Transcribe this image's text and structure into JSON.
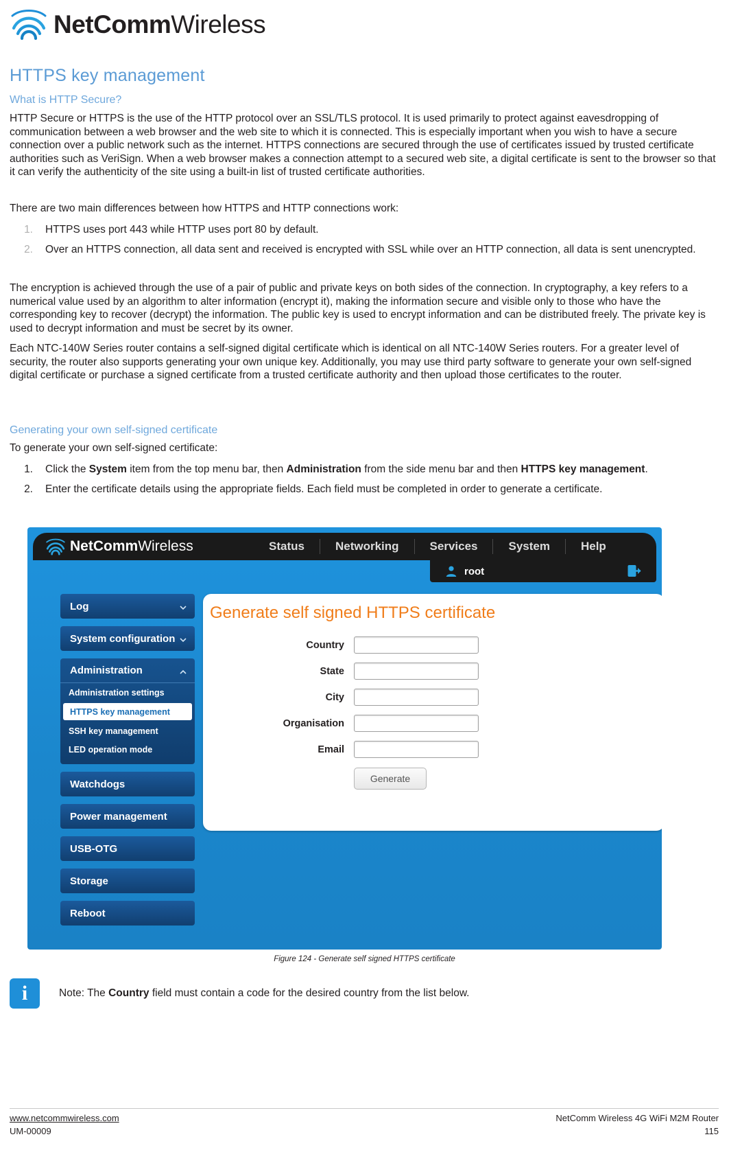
{
  "brand": {
    "name_bold": "NetComm",
    "name_light": "Wireless",
    "logo_icon": "wifi-wave-logo"
  },
  "document": {
    "title": "HTTPS key management",
    "subheading_1": "What is HTTP Secure?",
    "paragraphs": {
      "p1": "HTTP Secure or HTTPS is the use of the HTTP protocol over an SSL/TLS protocol. It is used primarily to protect against eavesdropping of communication between a web browser and the web site to which it is connected. This is especially important when you wish to have a secure connection over a public network such as the internet. HTTPS connections are secured through the use of certificates issued by trusted certificate authorities such as VeriSign. When a web browser makes a connection attempt to a secured web site, a digital certificate is sent to the browser so that it can verify the authenticity of the site using a built-in list of trusted certificate authorities.",
      "p2": "There are two main differences between how HTTPS and HTTP connections work:",
      "p3": "The encryption is achieved through the use of a pair of public and private keys on both sides of the connection. In cryptography, a key refers to a numerical value used by an algorithm to alter information (encrypt it), making the information secure and visible only to those who have the corresponding key to recover (decrypt) the information. The public key is used to encrypt information and can be distributed freely. The private key is used to decrypt information and must be secret by its owner.",
      "p4": "Each NTC-140W Series router contains a self-signed digital certificate which is identical on all NTC-140W Series routers. For a greater level of security, the router also supports generating your own unique key. Additionally, you may use third party software to generate your own self-signed digital certificate or purchase a signed certificate from a trusted certificate authority and then upload those certificates to the router."
    },
    "list_1": [
      {
        "num": "1.",
        "text": "HTTPS uses port 443 while HTTP uses port 80 by default."
      },
      {
        "num": "2.",
        "text": "Over an HTTPS connection, all data sent and received is encrypted with SSL while over an HTTP connection, all data is sent unencrypted."
      }
    ],
    "subheading_2": "Generating your own self-signed certificate",
    "intro_2": "To generate your own self-signed certificate:",
    "list_2": [
      {
        "num": "1.",
        "segments": [
          {
            "text": "Click the ",
            "bold": false
          },
          {
            "text": "System",
            "bold": true
          },
          {
            "text": " item from the top menu bar, then ",
            "bold": false
          },
          {
            "text": "Administration",
            "bold": true
          },
          {
            "text": " from the side menu bar and then ",
            "bold": false
          },
          {
            "text": "HTTPS key management",
            "bold": true
          },
          {
            "text": ".",
            "bold": false
          }
        ]
      },
      {
        "num": "2.",
        "segments": [
          {
            "text": "Enter the certificate details using the appropriate fields. Each field must be completed in order to generate a certificate.",
            "bold": false
          }
        ]
      }
    ],
    "figure_caption": "Figure 124 - Generate self signed HTTPS certificate",
    "note": {
      "icon_label": "i",
      "icon_name": "info-icon",
      "prefix": "Note: The ",
      "bold": "Country",
      "suffix": " field must contain a code for the desired country from the list below."
    }
  },
  "router_ui": {
    "logo_bold": "NetComm",
    "logo_light": "Wireless",
    "top_menu": [
      "Status",
      "Networking",
      "Services",
      "System",
      "Help"
    ],
    "user": "root",
    "user_icon": "user-icon",
    "logout_icon": "logout-icon",
    "sidebar": [
      {
        "label": "Log",
        "type": "collapsible",
        "chevron": "chevron-down-icon"
      },
      {
        "label": "System configuration",
        "type": "collapsible",
        "chevron": "chevron-down-icon"
      }
    ],
    "sidebar_group": {
      "label": "Administration",
      "chevron": "chevron-up-icon",
      "items": [
        {
          "label": "Administration settings",
          "active": false
        },
        {
          "label": "HTTPS key management",
          "active": true
        },
        {
          "label": "SSH key management",
          "active": false
        },
        {
          "label": "LED operation mode",
          "active": false
        }
      ]
    },
    "sidebar_rest": [
      {
        "label": "Watchdogs",
        "chevron": ""
      },
      {
        "label": "Power management",
        "chevron": ""
      },
      {
        "label": "USB-OTG",
        "chevron": ""
      },
      {
        "label": "Storage",
        "chevron": ""
      },
      {
        "label": "Reboot",
        "chevron": ""
      }
    ],
    "panel": {
      "title": "Generate self signed HTTPS certificate",
      "fields": [
        {
          "label": "Country",
          "value": ""
        },
        {
          "label": "State",
          "value": ""
        },
        {
          "label": "City",
          "value": ""
        },
        {
          "label": "Organisation",
          "value": ""
        },
        {
          "label": "Email",
          "value": ""
        }
      ],
      "button": "Generate"
    }
  },
  "footer": {
    "website": "www.netcommwireless.com",
    "doc_id": "UM-00009",
    "product": "NetComm Wireless 4G WiFi M2M Router",
    "page": "115"
  },
  "colors": {
    "heading_blue": "#5b9bd5",
    "router_blue": "#1f8fd8",
    "panel_orange": "#f07d1a",
    "sidebar_navy": "#14477d"
  }
}
